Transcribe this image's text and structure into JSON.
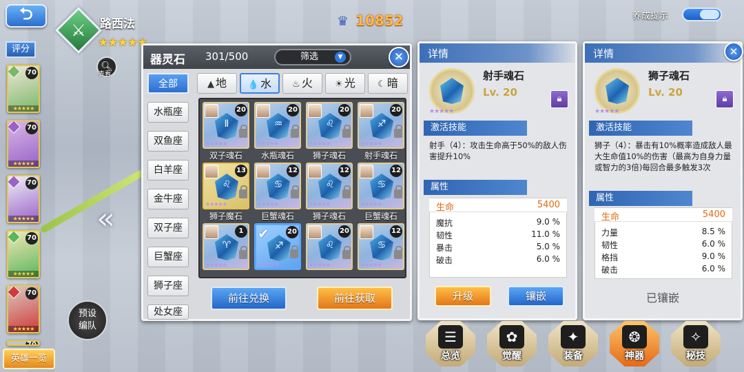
{
  "header": {
    "hero_name": "路西法",
    "hero_stars": "★★★★★",
    "view_label": "查看",
    "power": "10852",
    "hint_label": "养成提示",
    "score_label": "评分"
  },
  "sidebar": {
    "heroes": [
      {
        "level": "70",
        "stars": "★★★★★",
        "color": "#7ab86a",
        "face": "#efe6d6"
      },
      {
        "level": "70",
        "stars": "★★★★★",
        "color": "#9a62c8",
        "face": "#d8b9e6"
      },
      {
        "level": "70",
        "stars": "★★★★★",
        "color": "#9a62c8",
        "face": "#eef0f7"
      },
      {
        "level": "70",
        "stars": "★★★★★",
        "color": "#5ab85a",
        "face": "#f4e6b8"
      },
      {
        "level": "70",
        "stars": "★★★★★",
        "color": "#d03a3a",
        "face": "#d9c9bf"
      }
    ],
    "extra_level": "70",
    "heroes_button": "英雄一览",
    "preset_button": "预设\n编队"
  },
  "inventory": {
    "title": "器灵石",
    "count": "301/500",
    "filter_label": "筛选",
    "close": "✕",
    "elements": [
      {
        "label": "地",
        "icon": "▲"
      },
      {
        "label": "水",
        "icon": "💧"
      },
      {
        "label": "火",
        "icon": "♨"
      },
      {
        "label": "光",
        "icon": "☀"
      },
      {
        "label": "暗",
        "icon": "☾"
      }
    ],
    "zodiac_tabs": [
      "全部",
      "水瓶座",
      "双鱼座",
      "白羊座",
      "金牛座",
      "双子座",
      "巨蟹座",
      "狮子座",
      "处女座"
    ],
    "items": [
      {
        "name": "双子魂石",
        "level": "20",
        "glyph": "Ⅱ",
        "frame": "normal"
      },
      {
        "name": "水瓶魂石",
        "level": "20",
        "glyph": "♒",
        "frame": "normal"
      },
      {
        "name": "狮子魂石",
        "level": "20",
        "glyph": "♌",
        "frame": "normal"
      },
      {
        "name": "射手魂石",
        "level": "20",
        "glyph": "♐",
        "frame": "normal"
      },
      {
        "name": "狮子魔石",
        "level": "13",
        "glyph": "♌",
        "frame": "gold"
      },
      {
        "name": "巨蟹魂石",
        "level": "12",
        "glyph": "♋",
        "frame": "normal"
      },
      {
        "name": "狮子魂石",
        "level": "12",
        "glyph": "♌",
        "frame": "normal"
      },
      {
        "name": "巨蟹魂石",
        "level": "12",
        "glyph": "♋",
        "frame": "normal"
      },
      {
        "name": "",
        "level": "1",
        "glyph": "♈",
        "frame": "normal"
      },
      {
        "name": "",
        "level": "20",
        "glyph": "♐",
        "frame": "selected"
      },
      {
        "name": "",
        "level": "20",
        "glyph": "♌",
        "frame": "normal"
      },
      {
        "name": "",
        "level": "12",
        "glyph": "♋",
        "frame": "normal"
      }
    ],
    "exchange_button": "前往兑换",
    "obtain_button": "前往获取"
  },
  "detail_left": {
    "header": "详情",
    "name": "射手魂石",
    "level": "Lv. 20",
    "glyph": "♐",
    "skill_header": "激活技能",
    "skill_text": "射手（4）：攻击生命高于50%的敌人伤害提升10%",
    "attr_header": "属性",
    "hp_label": "生命",
    "hp_value": "5400",
    "stats": [
      {
        "k": "魔抗",
        "v": "9.0 %"
      },
      {
        "k": "韧性",
        "v": "11.0 %"
      },
      {
        "k": "暴击",
        "v": "5.0 %"
      },
      {
        "k": "破击",
        "v": "6.0 %"
      }
    ],
    "upgrade_button": "升级",
    "inlay_button": "镶嵌"
  },
  "detail_right": {
    "header": "详情",
    "name": "狮子魂石",
    "level": "Lv. 20",
    "glyph": "♌",
    "skill_header": "激活技能",
    "skill_text": "狮子（4）：暴击有10%概率造成敌人最大生命值10%的伤害（最高为自身力量或智力的3倍)每回合最多触发3次",
    "attr_header": "属性",
    "hp_label": "生命",
    "hp_value": "5400",
    "stats": [
      {
        "k": "力量",
        "v": "8.5 %"
      },
      {
        "k": "韧性",
        "v": "6.0 %"
      },
      {
        "k": "格挡",
        "v": "9.0 %"
      },
      {
        "k": "破击",
        "v": "6.0 %"
      }
    ],
    "status": "已镶嵌",
    "close": "✕"
  },
  "bottom_tabs": [
    {
      "label": "总览",
      "icon": "☰",
      "active": false
    },
    {
      "label": "觉醒",
      "icon": "✿",
      "active": false
    },
    {
      "label": "装备",
      "icon": "✦",
      "active": false
    },
    {
      "label": "神器",
      "icon": "❂",
      "active": true
    },
    {
      "label": "秘技",
      "icon": "✧",
      "active": false
    }
  ]
}
